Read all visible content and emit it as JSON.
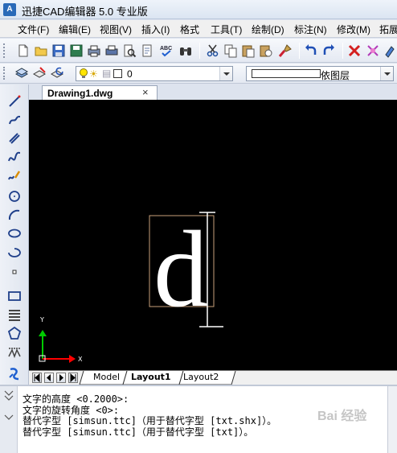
{
  "window": {
    "title": "迅捷CAD编辑器 5.0 专业版",
    "app_icon_text": "A"
  },
  "menu": [
    "文件(F)",
    "编辑(E)",
    "视图(V)",
    "插入(I)",
    "格式",
    "工具(T)",
    "绘制(D)",
    "标注(N)",
    "修改(M)",
    "拓展"
  ],
  "layer_toolbar": {
    "layer_name": "0",
    "linetype_value": "依图层"
  },
  "document_tab": {
    "label": "Drawing1.dwg",
    "close": "×"
  },
  "canvas": {
    "text_entity": "d",
    "ucs_x_label": "X",
    "ucs_y_label": "Y"
  },
  "layout_tabs": [
    "Model",
    "Layout1",
    "Layout2"
  ],
  "active_layout": "Layout1",
  "command_lines": [
    "文字的高度 <0.2000>:",
    "文字的旋转角度 <0>:",
    "替代字型 [simsun.ttc]（用于替代字型 [txt.shx]）。",
    "替代字型 [simsun.ttc]（用于替代字型 [txt]）。"
  ],
  "watermark": "Bai 经验",
  "colors": {
    "canvas_bg": "#000000",
    "ucs_x": "#ff0000",
    "ucs_y": "#00cc00",
    "bounding_box": "#c8a07a"
  }
}
